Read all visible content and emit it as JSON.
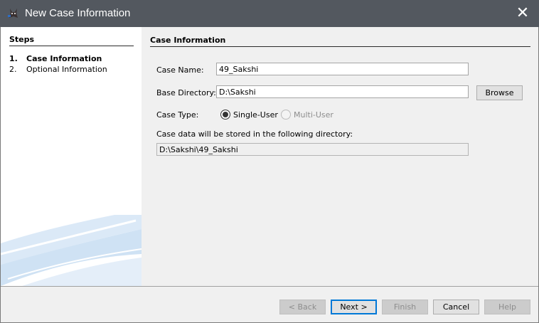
{
  "window": {
    "title": "New Case Information",
    "close_glyph": "✕",
    "icon": "app-icon"
  },
  "steps": {
    "header": "Steps",
    "items": [
      {
        "num": "1.",
        "label": "Case Information",
        "active": true
      },
      {
        "num": "2.",
        "label": "Optional Information",
        "active": false
      }
    ]
  },
  "panel": {
    "header": "Case Information",
    "case_name_label": "Case Name:",
    "case_name_value": "49_Sakshi",
    "base_dir_label": "Base Directory:",
    "base_dir_value": "D:\\Sakshi",
    "browse_label": "Browse",
    "case_type_label": "Case Type:",
    "single_user_label": "Single-User",
    "multi_user_label": "Multi-User",
    "case_type_selected": "Single-User",
    "storage_label": "Case data will be stored in the following directory:",
    "storage_value": "D:\\Sakshi\\49_Sakshi"
  },
  "buttons": {
    "back": "< Back",
    "next": "Next >",
    "finish": "Finish",
    "cancel": "Cancel",
    "help": "Help"
  }
}
